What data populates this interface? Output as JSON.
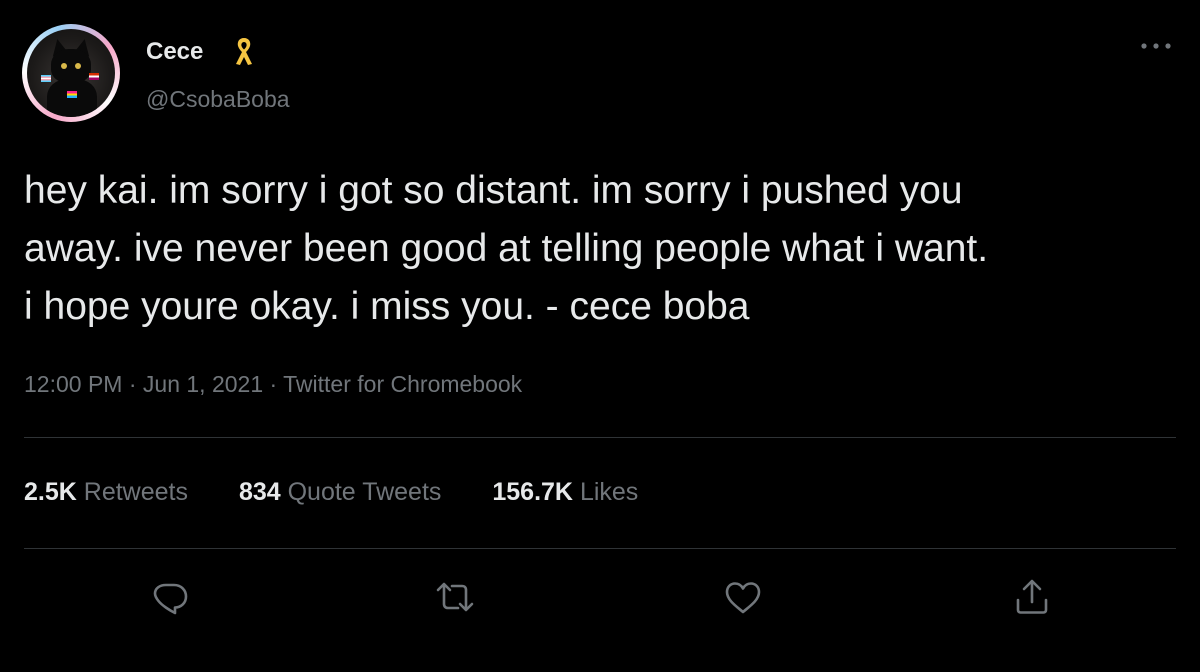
{
  "author": {
    "display_name": "Cece",
    "handle": "@CsobaBoba",
    "badge_icon": "ribbon-icon",
    "badge_color": "#f5c542"
  },
  "tweet": {
    "text": "hey kai. im sorry i got so distant. im sorry i pushed you\naway. ive never been good at telling people what i want.\ni hope youre okay. i miss you. - cece boba",
    "time": "12:00 PM",
    "separator": " · ",
    "date": "Jun 1, 2021",
    "source": "Twitter for Chromebook"
  },
  "stats": {
    "retweets": {
      "count": "2.5K",
      "label": "Retweets"
    },
    "quote_tweets": {
      "count": "834",
      "label": "Quote Tweets"
    },
    "likes": {
      "count": "156.7K",
      "label": "Likes"
    }
  },
  "actions": [
    "reply-icon",
    "retweet-icon",
    "like-icon",
    "share-icon"
  ],
  "colors": {
    "background": "#000000",
    "text": "#e7e9ea",
    "muted": "#71767b",
    "divider": "#2f3336"
  }
}
